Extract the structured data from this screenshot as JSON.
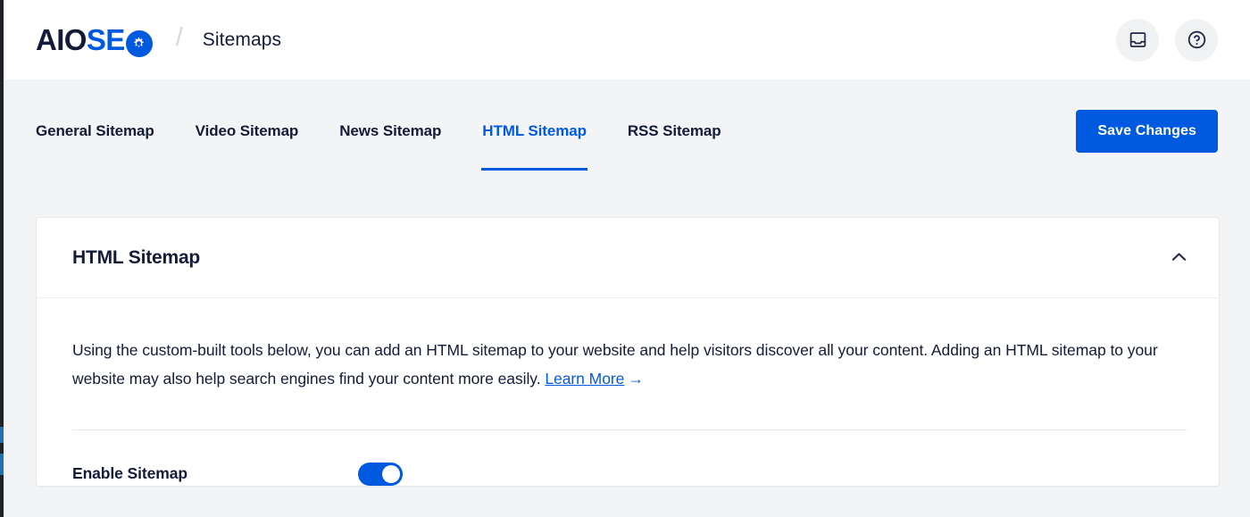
{
  "header": {
    "logo": {
      "part1": "AIO",
      "part2": "SE",
      "icon": "gear-in-circle-icon",
      "colors": {
        "dark": "#141b38",
        "blue": "#005ae0"
      }
    },
    "breadcrumb_separator": "/",
    "breadcrumb_current": "Sitemaps",
    "actions": [
      {
        "name": "notifications-inbox-button",
        "icon": "inbox-icon"
      },
      {
        "name": "help-button",
        "icon": "question-mark-circle-icon"
      }
    ]
  },
  "tabs": {
    "items": [
      {
        "label": "General Sitemap",
        "active": false
      },
      {
        "label": "Video Sitemap",
        "active": false
      },
      {
        "label": "News Sitemap",
        "active": false
      },
      {
        "label": "HTML Sitemap",
        "active": true
      },
      {
        "label": "RSS Sitemap",
        "active": false
      }
    ],
    "save_label": "Save Changes",
    "accent_color": "#005ae0"
  },
  "card": {
    "title": "HTML Sitemap",
    "collapse_icon": "chevron-up-icon",
    "description_part1": "Using the custom-built tools below, you can add an HTML sitemap to your website and help visitors discover all your content. Adding an HTML sitemap to your website may also help search engines find your content more easily. ",
    "learn_more_label": "Learn More",
    "learn_more_arrow": "→",
    "settings": [
      {
        "label": "Enable Sitemap",
        "control": "toggle",
        "value": "on"
      }
    ]
  }
}
